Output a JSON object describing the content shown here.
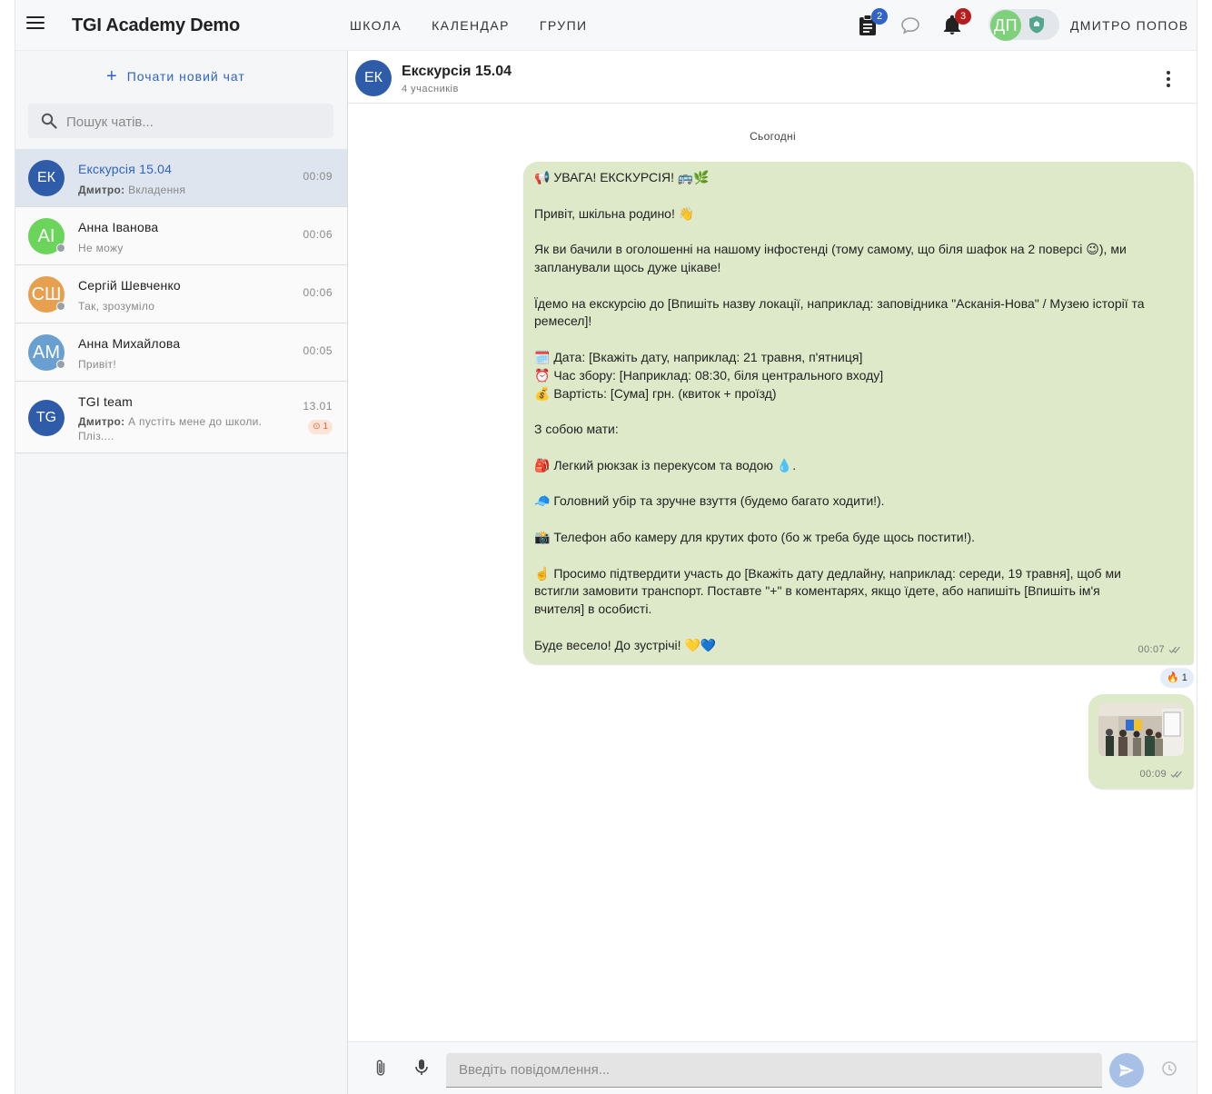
{
  "app": {
    "title": "TGI Academy Demo"
  },
  "nav": [
    {
      "label": "ШКОЛА"
    },
    {
      "label": "КАЛЕНДАР"
    },
    {
      "label": "ГРУПИ"
    }
  ],
  "top_icons": {
    "tasks_badge": "2",
    "notifications_badge": "3"
  },
  "user": {
    "initials": "ДП",
    "name": "ДМИТРО ПОПОВ",
    "avatar_color": "#7ed07a"
  },
  "sidebar": {
    "new_chat_label": "Почати новий чат",
    "search_placeholder": "Пошук чатів...",
    "chats": [
      {
        "initials": "ЕК",
        "name": "Екскурсія 15.04",
        "sender": "Дмитро:",
        "preview": "Вкладення",
        "time": "00:09",
        "color": "#2f5ca8",
        "active": true
      },
      {
        "initials": "АІ",
        "name": "Анна Іванова",
        "sender": "",
        "preview": "Не можу",
        "time": "00:06",
        "color": "#6bd45a"
      },
      {
        "initials": "СШ",
        "name": "Сергій Шевченко",
        "sender": "",
        "preview": "Так, зрозуміло",
        "time": "00:06",
        "color": "#e6a04f"
      },
      {
        "initials": "АМ",
        "name": "Анна Михайлова",
        "sender": "",
        "preview": "Привіт!",
        "time": "00:05",
        "color": "#6a9fd1"
      },
      {
        "initials": "TG",
        "name": "TGI team",
        "sender": "Дмитро:",
        "preview": "А пустіть мене до школи. Пліз....",
        "time": "13.01",
        "unread": "1",
        "color": "#2f5ca8"
      }
    ]
  },
  "chat": {
    "avatar": "ЕК",
    "title": "Екскурсія 15.04",
    "subtitle": "4 учасників",
    "day_separator": "Сьогодні",
    "message1": {
      "lines": [
        "📢 УВАГА! ЕКСКУРСІЯ! 🚌🌿",
        "",
        "Привіт, шкільна родино! 👋",
        "",
        "Як ви бачили в оголошенні на нашому інфостенді (тому самому, що біля шафок на 2 поверсі 😉), ми",
        "запланували щось дуже цікаве!",
        "",
        "Їдемо на екскурсію до [Впишіть назву локації, наприклад: заповідника \"Асканія-Нова\" / Музею історії та",
        "ремесел]!",
        "",
        "🗓️ Дата: [Вкажіть дату, наприклад: 21 травня, п'ятниця]",
        "⏰ Час збору: [Наприклад: 08:30, біля центрального входу]",
        "💰 Вартість: [Сума] грн. (квиток + проїзд)",
        "",
        "З собою мати:",
        "",
        "🎒 Легкий рюкзак із перекусом та водою 💧.",
        "",
        "🧢 Головний убір та зручне взуття (будемо багато ходити!).",
        "",
        "📸 Телефон або камеру для крутих фото (бо ж треба буде щось постити!).",
        "",
        "☝️ Просимо підтвердити участь до [Вкажіть дату дедлайну, наприклад: середи, 19 травня], щоб ми",
        "встигли замовити транспорт. Поставте \"+\" в коментарях, якщо їдете, або напишіть [Впишіть ім'я",
        "вчителя] в особисті.",
        "",
        "Буде весело! До зустрічі! 💛💙"
      ],
      "time": "00:07",
      "reaction": "🔥 1"
    },
    "message2": {
      "time": "00:09"
    },
    "composer_placeholder": "Введіть повідомлення..."
  },
  "colors": {
    "accent": "#2f63c5",
    "bubble": "#dde9c8",
    "active_chat": "#dfe5ef"
  }
}
